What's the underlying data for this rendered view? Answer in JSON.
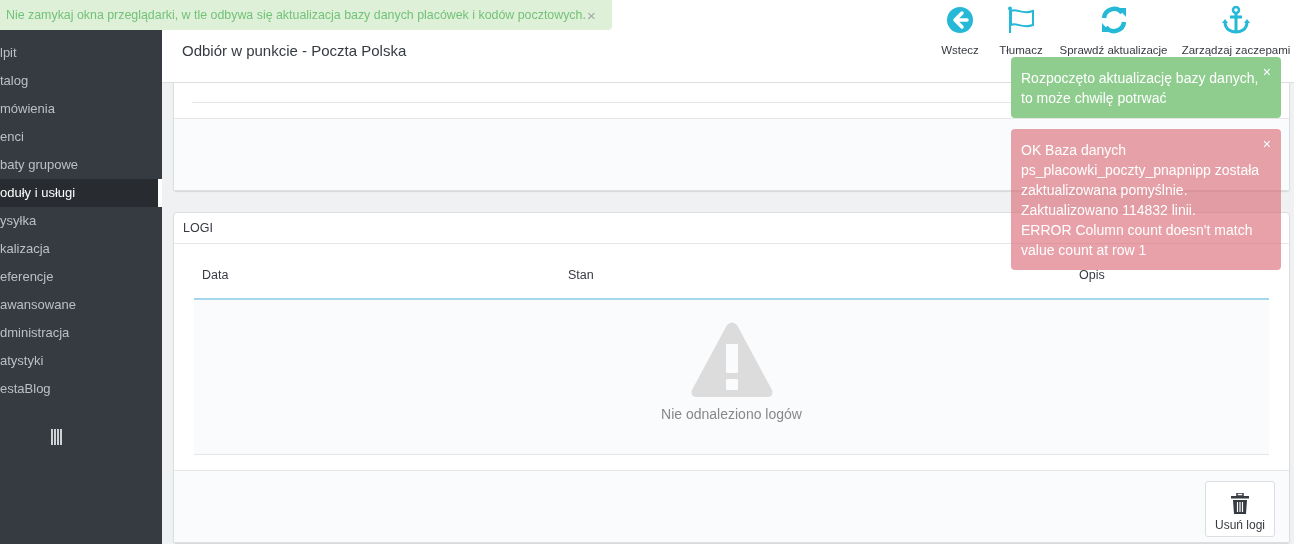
{
  "notice": {
    "text": "Nie zamykaj okna przeglądarki, w tle odbywa się aktualizacja bazy danych placówek i kodów pocztowych.",
    "close": "×"
  },
  "sidebar": {
    "items": [
      {
        "label": "lpit",
        "selected": false
      },
      {
        "label": "talog",
        "selected": false
      },
      {
        "label": "mówienia",
        "selected": false
      },
      {
        "label": "enci",
        "selected": false
      },
      {
        "label": "baty grupowe",
        "selected": false
      },
      {
        "label": "oduły i usługi",
        "selected": true
      },
      {
        "label": "ysyłka",
        "selected": false
      },
      {
        "label": "kalizacja",
        "selected": false
      },
      {
        "label": "eferencje",
        "selected": false
      },
      {
        "label": "awansowane",
        "selected": false
      },
      {
        "label": "dministracja",
        "selected": false
      },
      {
        "label": "atystyki",
        "selected": false
      },
      {
        "label": "estaBlog",
        "selected": false
      }
    ]
  },
  "page_header": {
    "subtitle": "Odbiór w punkcie - Poczta Polska"
  },
  "toolbar": [
    {
      "kind": "back",
      "label": "Wstecz"
    },
    {
      "kind": "translate",
      "label": "Tłumacz"
    },
    {
      "kind": "refresh",
      "label": "Sprawdź aktualizacje"
    },
    {
      "kind": "anchor",
      "label": "Zarządzaj zaczepami"
    }
  ],
  "logs_panel": {
    "title": "LOGI",
    "columns": [
      "Data",
      "Stan",
      "Opis"
    ],
    "empty_message": "Nie odnaleziono logów",
    "button": "Usuń logi"
  },
  "toasts": [
    {
      "kind": "success",
      "lines": [
        "Rozpoczęto aktualizację bazy danych, to może chwilę potrwać"
      ],
      "close": "×"
    },
    {
      "kind": "error",
      "lines": [
        "OK Baza danych ps_placowki_poczty_pnapnipp została zaktualizowana pomyślnie. Zaktualizowano 114832 linii.",
        "ERROR Column count doesn't match value count at row 1"
      ],
      "close": "×"
    }
  ]
}
